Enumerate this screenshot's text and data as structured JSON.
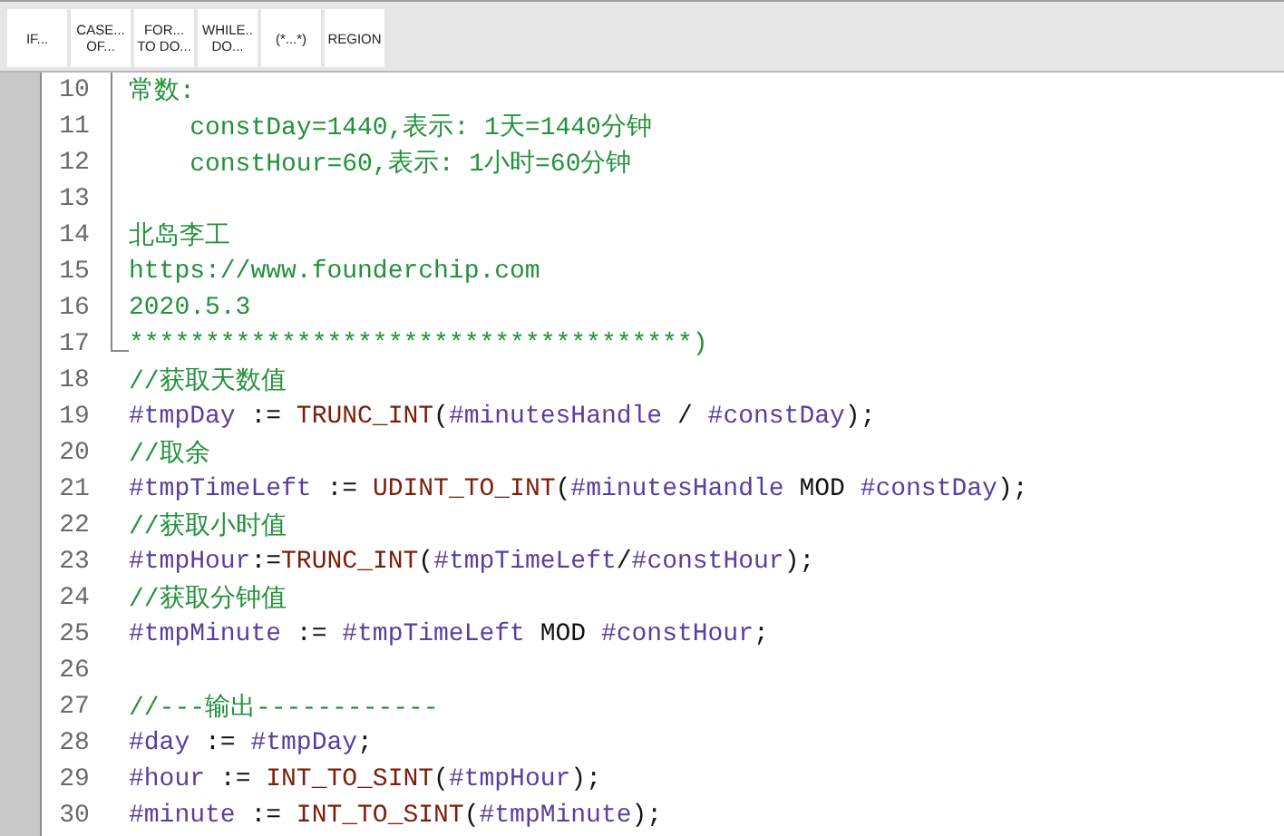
{
  "toolbar": {
    "buttons": [
      {
        "lines": [
          "IF..."
        ]
      },
      {
        "lines": [
          "CASE...",
          "OF..."
        ]
      },
      {
        "lines": [
          "FOR...",
          "TO DO..."
        ]
      },
      {
        "lines": [
          "WHILE..",
          "DO..."
        ]
      },
      {
        "lines": [
          "(*...*)"
        ]
      },
      {
        "lines": [
          "REGION"
        ]
      }
    ]
  },
  "editor": {
    "lines": [
      {
        "number": "10",
        "kind": "comment_block",
        "segments": [
          {
            "kind": "comment",
            "text": "常数:"
          }
        ]
      },
      {
        "number": "11",
        "kind": "comment_block",
        "segments": [
          {
            "kind": "comment",
            "text": "    constDay=1440,表示: 1天=1440分钟"
          }
        ]
      },
      {
        "number": "12",
        "kind": "comment_block",
        "segments": [
          {
            "kind": "comment",
            "text": "    constHour=60,表示: 1小时=60分钟"
          }
        ]
      },
      {
        "number": "13",
        "kind": "comment_block"
      },
      {
        "number": "14",
        "kind": "comment_block",
        "segments": [
          {
            "kind": "comment",
            "text": "北岛李工"
          }
        ]
      },
      {
        "number": "15",
        "kind": "comment_block",
        "segments": [
          {
            "kind": "comment",
            "text": "https://www.founderchip.com"
          }
        ]
      },
      {
        "number": "16",
        "kind": "comment_block",
        "segments": [
          {
            "kind": "comment",
            "text": "2020.5.3"
          }
        ]
      },
      {
        "number": "17",
        "kind": "comment_block",
        "segments": [
          {
            "kind": "comment",
            "text": "*************************************)"
          }
        ]
      },
      {
        "number": "18",
        "kind": "code",
        "segments": [
          {
            "kind": "comment",
            "text": "//获取天数值"
          }
        ]
      },
      {
        "number": "19",
        "kind": "code",
        "segments": [
          {
            "kind": "variable",
            "text": "#tmpDay"
          },
          {
            "kind": "operator",
            "text": " := "
          },
          {
            "kind": "function",
            "text": "TRUNC_INT"
          },
          {
            "kind": "operator",
            "text": "("
          },
          {
            "kind": "variable",
            "text": "#minutesHandle"
          },
          {
            "kind": "operator",
            "text": " / "
          },
          {
            "kind": "variable",
            "text": "#constDay"
          },
          {
            "kind": "operator",
            "text": ");"
          }
        ]
      },
      {
        "number": "20",
        "kind": "code",
        "segments": [
          {
            "kind": "comment",
            "text": "//取余"
          }
        ]
      },
      {
        "number": "21",
        "kind": "code",
        "segments": [
          {
            "kind": "variable",
            "text": "#tmpTimeLeft"
          },
          {
            "kind": "operator",
            "text": " := "
          },
          {
            "kind": "function",
            "text": "UDINT_TO_INT"
          },
          {
            "kind": "operator",
            "text": "("
          },
          {
            "kind": "variable",
            "text": "#minutesHandle"
          },
          {
            "kind": "operator",
            "text": " MOD "
          },
          {
            "kind": "variable",
            "text": "#constDay"
          },
          {
            "kind": "operator",
            "text": ");"
          }
        ]
      },
      {
        "number": "22",
        "kind": "code",
        "segments": [
          {
            "kind": "comment",
            "text": "//获取小时值"
          }
        ]
      },
      {
        "number": "23",
        "kind": "code",
        "segments": [
          {
            "kind": "variable",
            "text": "#tmpHour"
          },
          {
            "kind": "operator",
            "text": ":="
          },
          {
            "kind": "function",
            "text": "TRUNC_INT"
          },
          {
            "kind": "operator",
            "text": "("
          },
          {
            "kind": "variable",
            "text": "#tmpTimeLeft"
          },
          {
            "kind": "operator",
            "text": "/"
          },
          {
            "kind": "variable",
            "text": "#constHour"
          },
          {
            "kind": "operator",
            "text": ");"
          }
        ]
      },
      {
        "number": "24",
        "kind": "code",
        "segments": [
          {
            "kind": "comment",
            "text": "//获取分钟值"
          }
        ]
      },
      {
        "number": "25",
        "kind": "code",
        "segments": [
          {
            "kind": "variable",
            "text": "#tmpMinute"
          },
          {
            "kind": "operator",
            "text": " := "
          },
          {
            "kind": "variable",
            "text": "#tmpTimeLeft"
          },
          {
            "kind": "operator",
            "text": " MOD "
          },
          {
            "kind": "variable",
            "text": "#constHour"
          },
          {
            "kind": "operator",
            "text": ";"
          }
        ]
      },
      {
        "number": "26",
        "kind": "code"
      },
      {
        "number": "27",
        "kind": "code",
        "segments": [
          {
            "kind": "comment",
            "text": "//---输出------------"
          }
        ]
      },
      {
        "number": "28",
        "kind": "code",
        "segments": [
          {
            "kind": "variable",
            "text": "#day"
          },
          {
            "kind": "operator",
            "text": " := "
          },
          {
            "kind": "variable",
            "text": "#tmpDay"
          },
          {
            "kind": "operator",
            "text": ";"
          }
        ]
      },
      {
        "number": "29",
        "kind": "code",
        "segments": [
          {
            "kind": "variable",
            "text": "#hour"
          },
          {
            "kind": "operator",
            "text": " := "
          },
          {
            "kind": "function",
            "text": "INT_TO_SINT"
          },
          {
            "kind": "operator",
            "text": "("
          },
          {
            "kind": "variable",
            "text": "#tmpHour"
          },
          {
            "kind": "operator",
            "text": ");"
          }
        ]
      },
      {
        "number": "30",
        "kind": "code",
        "segments": [
          {
            "kind": "variable",
            "text": "#minute"
          },
          {
            "kind": "operator",
            "text": " := "
          },
          {
            "kind": "function",
            "text": "INT_TO_SINT"
          },
          {
            "kind": "operator",
            "text": "("
          },
          {
            "kind": "variable",
            "text": "#tmpMinute"
          },
          {
            "kind": "operator",
            "text": ");"
          }
        ]
      }
    ]
  }
}
